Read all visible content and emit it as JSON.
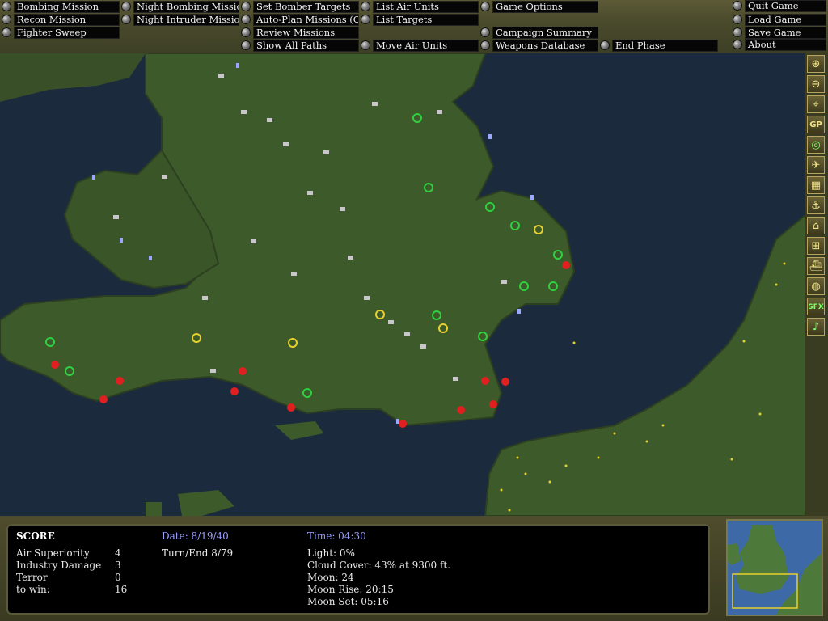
{
  "menu": {
    "bombing_mission": "Bombing Mission",
    "recon_mission": "Recon Mission",
    "fighter_sweep": "Fighter Sweep",
    "night_bombing": "Night Bombing Mission",
    "night_intruder": "Night Intruder Mission",
    "set_bomber_targets": "Set Bomber Targets",
    "auto_plan": "Auto-Plan Missions (Off)",
    "review_missions": "Review Missions",
    "show_all_paths": "Show All Paths",
    "list_air_units": "List Air Units",
    "list_targets": "List Targets",
    "move_air_units": "Move Air Units",
    "game_options": "Game Options",
    "campaign_summary": "Campaign Summary",
    "weapons_database": "Weapons Database",
    "end_phase": "End Phase",
    "quit_game": "Quit Game",
    "load_game": "Load Game",
    "save_game": "Save Game",
    "about": "About"
  },
  "tools": {
    "zoom_in": "zoom-in-icon",
    "zoom_out": "zoom-out-icon",
    "center": "crosshair-icon",
    "gp": "GP",
    "target": "target-icon",
    "aircraft": "aircraft-icon",
    "factory": "factory-icon",
    "anchor": "anchor-icon",
    "building": "building-icon",
    "bank": "bank-icon",
    "ship": "ship-icon",
    "compass": "compass-icon",
    "sfx": "SFX",
    "music": "music-note-icon"
  },
  "status": {
    "score_title": "SCORE",
    "air_superiority_label": "Air Superiority",
    "air_superiority_value": "4",
    "industry_damage_label": "Industry Damage",
    "industry_damage_value": "3",
    "terror_label": "Terror",
    "terror_value": "0",
    "to_win_label": "to win:",
    "to_win_value": "16",
    "date": "Date: 8/19/40",
    "turn": "Turn/End 8/79",
    "time": "Time: 04:30",
    "light": "Light: 0%",
    "cloud_cover": "Cloud Cover: 43% at 9300 ft.",
    "moon": "Moon: 24",
    "moon_rise": "Moon Rise: 20:15",
    "moon_set": "Moon Set: 05:16"
  },
  "colors": {
    "sea": "#1c2a3e",
    "land": "#3c5a2a",
    "continent": "#3d5a2a",
    "red_unit": "#e02020",
    "green_unit": "#30d040",
    "yellow_unit": "#e8d030",
    "factory": "#c8c8c8",
    "status_heading": "#9aa0ff"
  }
}
